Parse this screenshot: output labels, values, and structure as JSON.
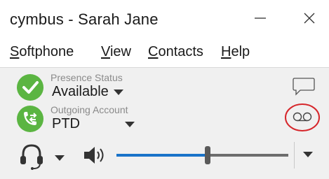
{
  "window": {
    "title": "cymbus - Sarah Jane",
    "minimize_icon": "minimize-icon",
    "close_icon": "close-icon"
  },
  "menu": {
    "items": [
      {
        "first": "S",
        "rest": "oftphone"
      },
      {
        "first": "V",
        "rest": "iew"
      },
      {
        "first": "C",
        "rest": "ontacts"
      },
      {
        "first": "H",
        "rest": "elp"
      }
    ]
  },
  "presence": {
    "label": "Presence Status",
    "value": "Available",
    "icon": "checkmark-icon",
    "color": "#5bb542"
  },
  "account": {
    "label": "Outgoing Account",
    "value": "PTD",
    "icon": "phone-transfer-icon",
    "color": "#5bb542"
  },
  "icons": {
    "chat": "chat-bubble-icon",
    "voicemail": "voicemail-icon",
    "headset": "headset-icon",
    "speaker": "speaker-icon"
  },
  "volume": {
    "level": 0.53,
    "fill_color": "#1a73c9",
    "track_color": "#6d6d6d"
  },
  "colors": {
    "annotation_circle": "#d6262b",
    "panel_bg": "#f0f0f0"
  }
}
